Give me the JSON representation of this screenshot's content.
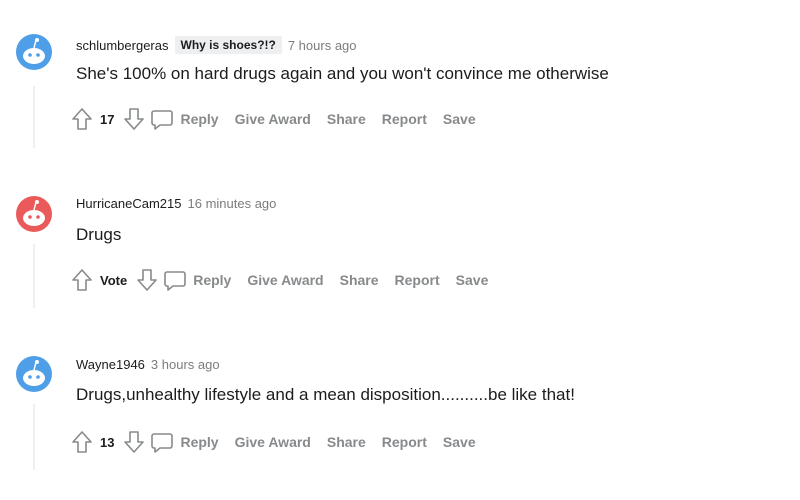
{
  "comments": [
    {
      "username": "schlumbergeras",
      "flair": "Why is shoes?!?",
      "time": "7 hours ago",
      "text": "She's 100% on hard drugs again and you won't convince me otherwise",
      "score": "17",
      "avatar_color": "#4f9ee8"
    },
    {
      "username": "HurricaneCam215",
      "flair": "",
      "time": "16 minutes ago",
      "text": "Drugs",
      "score": "Vote",
      "avatar_color": "#ea5a5a"
    },
    {
      "username": "Wayne1946",
      "flair": "",
      "time": "3 hours ago",
      "text": "Drugs,unhealthy lifestyle and a mean disposition..........be like that!",
      "score": "13",
      "avatar_color": "#4f9ee8"
    }
  ],
  "actions": {
    "reply": "Reply",
    "give_award": "Give Award",
    "share": "Share",
    "report": "Report",
    "save": "Save"
  },
  "icons": {
    "upvote": "upvote-arrow-icon",
    "downvote": "downvote-arrow-icon",
    "reply": "speech-bubble-icon",
    "avatar": "snoo-avatar-icon"
  }
}
